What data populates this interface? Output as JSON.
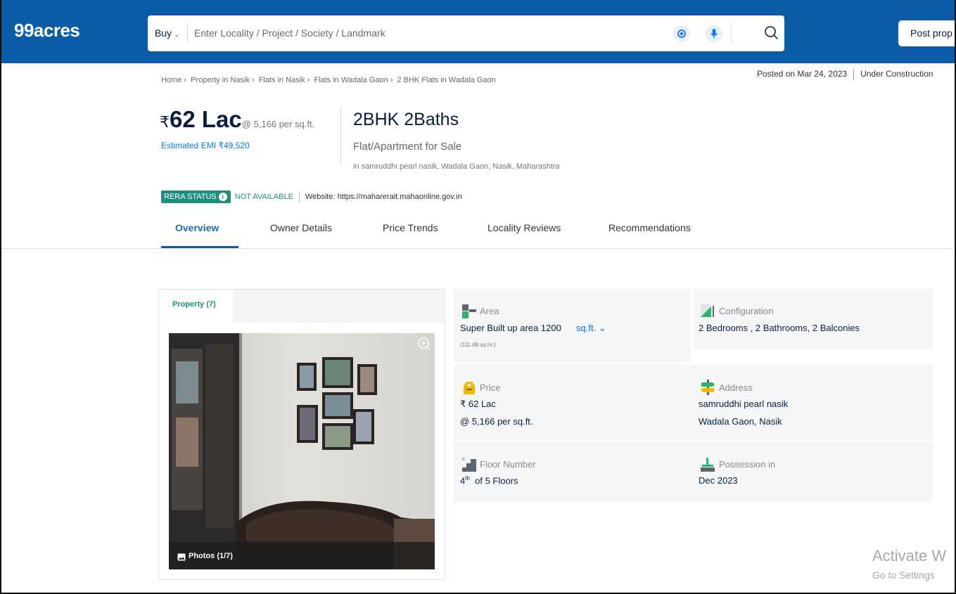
{
  "header": {
    "logo": "99acres",
    "buy_label": "Buy",
    "search_placeholder": "Enter Locality / Project / Society / Landmark",
    "post_property": "Post prop"
  },
  "breadcrumb": [
    "Home",
    "Property in Nasik",
    "Flats in Nasik",
    "Flats in Wadala Gaon",
    "2 BHK Flats in Wadala Gaon"
  ],
  "breadcrumb_separator": "›",
  "meta": {
    "posted": "Posted on Mar 24, 2023",
    "status": "Under Construction"
  },
  "price": {
    "currency": "₹",
    "amount": "62 Lac",
    "rate": "@ 5,166 per sq.ft.",
    "emi": "Estimated EMI ₹49,520"
  },
  "configuration": {
    "title": "2BHK 2Baths",
    "subtitle": "Flat/Apartment for Sale",
    "address": "in samruddhi pearl nasik, Wadala Gaon, Nasik, Maharashtra"
  },
  "rera": {
    "badge": "RERA STATUS",
    "info": "i",
    "status": "NOT AVAILABLE",
    "website": "Website: https://maharerait.mahaonline.gov.in"
  },
  "tabs": [
    "Overview",
    "Owner Details",
    "Price Trends",
    "Locality Reviews",
    "Recommendations"
  ],
  "photos": {
    "tab": "Property (7)",
    "counter": "Photos (1/7)"
  },
  "details": {
    "area": {
      "label": "Area",
      "value": "Super Built up area 1200",
      "unit": "sq.ft.",
      "sub": "(111.48 sq.m.)"
    },
    "configuration": {
      "label": "Configuration",
      "value": "2 Bedrooms , 2 Bathrooms, 2 Balconies"
    },
    "price": {
      "label": "Price",
      "value": "₹ 62 Lac",
      "rate": "@ 5,166 per sq.ft."
    },
    "address": {
      "label": "Address",
      "line1": "samruddhi pearl nasik",
      "line2": "Wadala Gaon, Nasik"
    },
    "floor": {
      "label": "Floor Number",
      "num": "4",
      "sup": "th",
      "rest": "of 5 Floors"
    },
    "possession": {
      "label": "Possession in",
      "value": "Dec 2023"
    }
  },
  "watermark": {
    "line1": "Activate W",
    "line2": "Go to Settings"
  },
  "colors": {
    "brand": "#0b5ba8",
    "rera_green": "#1f8e7c",
    "link": "#0078db"
  }
}
